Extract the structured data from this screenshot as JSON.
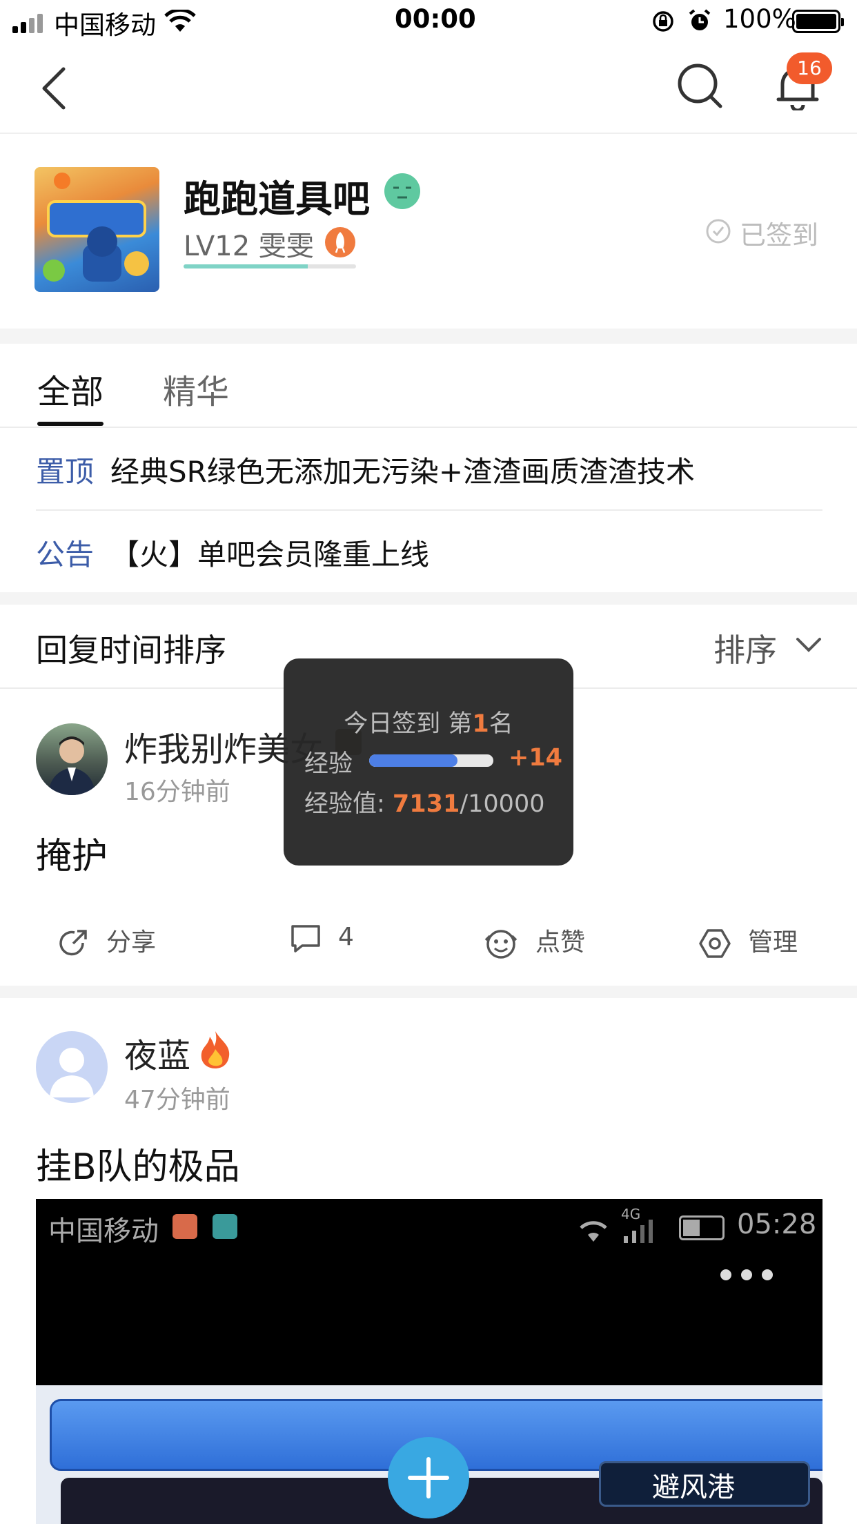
{
  "status_bar": {
    "carrier": "中国移动",
    "time": "00:00",
    "battery": "100%"
  },
  "nav": {
    "notification_count": "16"
  },
  "forum": {
    "name": "跑跑道具吧",
    "level": "LV12 雯雯",
    "signed_label": "已签到",
    "level_progress": 0.72
  },
  "tabs": [
    {
      "label": "全部"
    },
    {
      "label": "精华"
    }
  ],
  "notices": [
    {
      "tag": "置顶",
      "text": "经典SR绿色无添加无污染+渣渣画质渣渣技术"
    },
    {
      "tag": "公告",
      "text": "【火】单吧会员隆重上线"
    }
  ],
  "sort": {
    "title": "回复时间排序",
    "button": "排序"
  },
  "tooltip": {
    "prefix": "今日签到 第",
    "rank": "1",
    "suffix": "名",
    "exp_label": "经验",
    "exp_gain": "+14",
    "exp_value_label": "经验值: ",
    "exp_current": "7131",
    "exp_total": "/10000",
    "exp_progress": 0.7131
  },
  "posts": [
    {
      "username": "炸我别炸美女",
      "time": "16分钟前",
      "title": "掩护",
      "actions": {
        "share": "分享",
        "comments": "4",
        "like": "点赞",
        "manage": "管理"
      }
    },
    {
      "username": "夜蓝",
      "time": "47分钟前",
      "title": "挂B队的极品"
    }
  ],
  "embedded_screenshot": {
    "carrier": "中国移动",
    "network": "4G",
    "time": "05:28",
    "banner_text": "避风港"
  },
  "colors": {
    "accent_blue": "#3c5ca8",
    "badge": "#f25b2c",
    "orange": "#f07b3f",
    "fab": "#39a8e2"
  }
}
